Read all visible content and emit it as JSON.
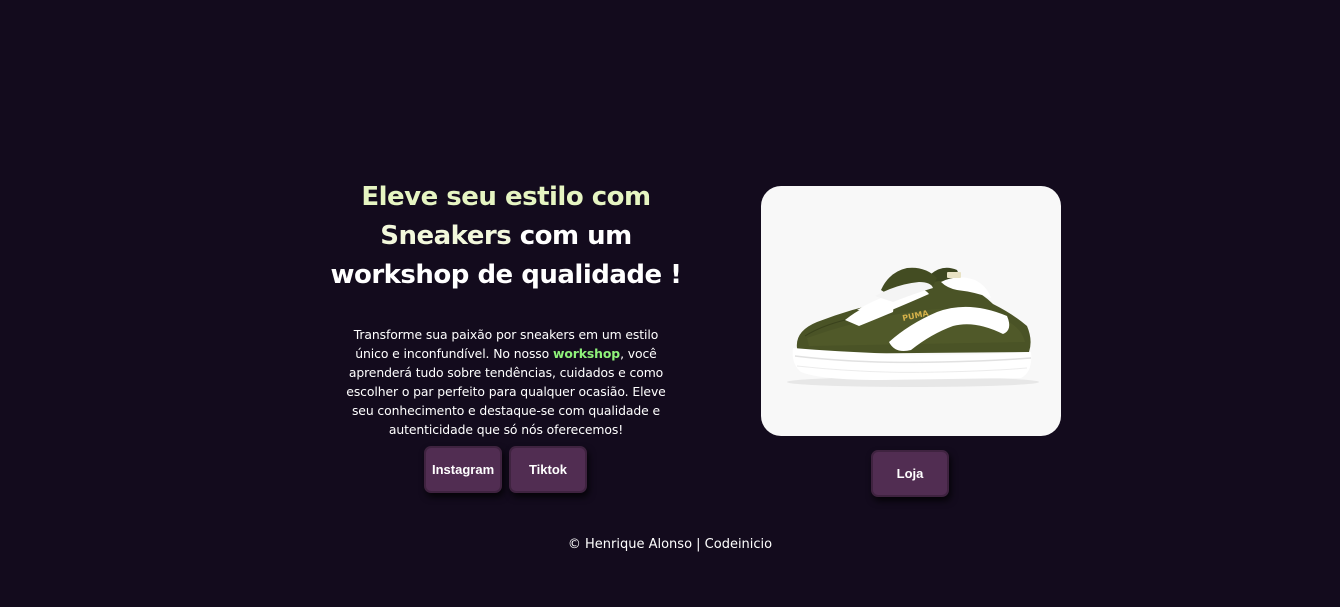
{
  "hero": {
    "headline_accent_1": "Eleve seu estilo com",
    "headline_accent_2": "Sneakers",
    "headline_rest_1": " com um",
    "headline_rest_2": "workshop de qualidade !",
    "desc_part_1": "Transforme sua paixão por sneakers em um estilo único e inconfundível. No nosso ",
    "desc_highlight": "workshop",
    "desc_part_2": ", você aprenderá tudo sobre tendências, cuidados e como escolher o par perfeito para qualquer ocasião. Eleve seu conhecimento e destaque-se com qualidade e autenticidade que só nós oferecemos!"
  },
  "social": {
    "instagram_label": "Instagram",
    "tiktok_label": "Tiktok"
  },
  "product": {
    "image": "green-suede-sneaker",
    "brand_mark": "PUMA",
    "shop_label": "Loja"
  },
  "footer": {
    "text": "© Henrique Alonso | Codeinicio"
  },
  "colors": {
    "background": "#130b1d",
    "button": "#512d52",
    "accent_green": "#8ff27a",
    "headline_tint": "#e6f5c2"
  }
}
